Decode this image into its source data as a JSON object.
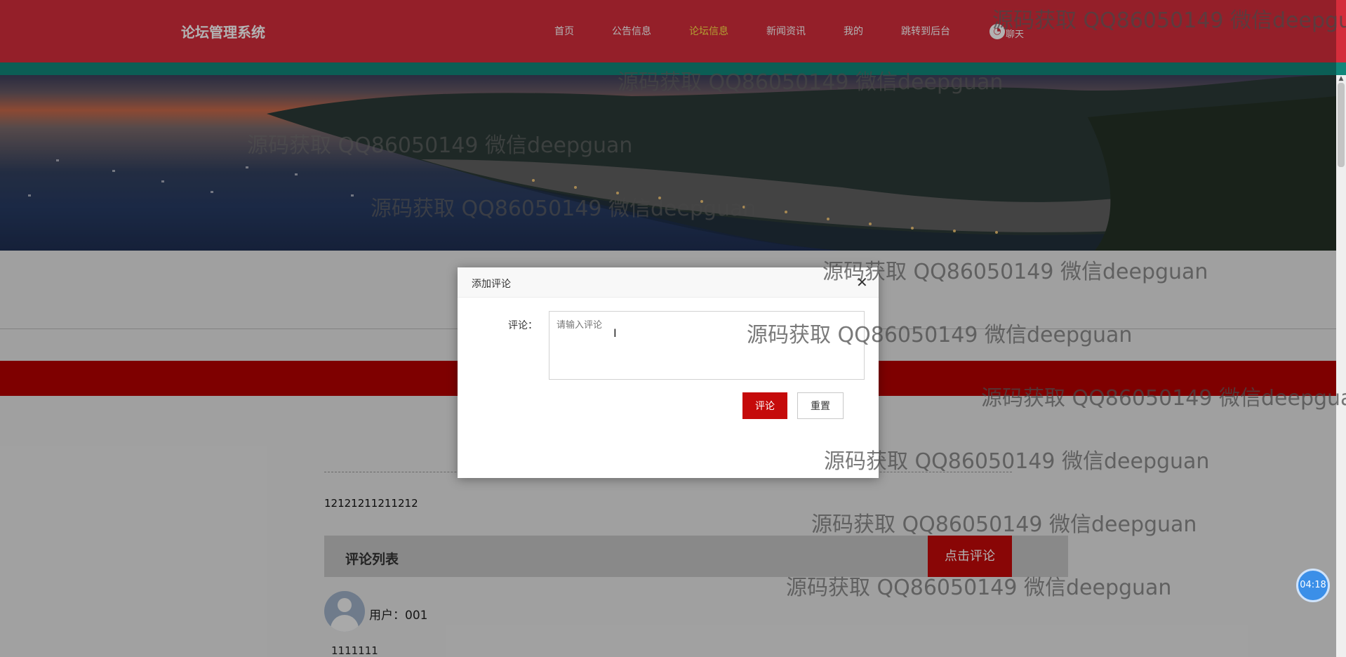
{
  "app": {
    "title": "论坛管理系统"
  },
  "nav": {
    "items": [
      {
        "label": "首页"
      },
      {
        "label": "公告信息"
      },
      {
        "label": "论坛信息",
        "active": true
      },
      {
        "label": "新闻资讯"
      },
      {
        "label": "我的"
      },
      {
        "label": "跳转到后台"
      }
    ],
    "chat_label": "聊天",
    "chat_icon": "chat-bubble-icon"
  },
  "colors": {
    "header": "#d42d3b",
    "stripe": "#10877a",
    "active_nav": "#ffe14a",
    "primary_button": "#c50a0a"
  },
  "post": {
    "content": "12121211211212"
  },
  "comments": {
    "title": "评论列表",
    "button_label": "点击评论",
    "items": [
      {
        "user_label": "用户：001",
        "text": "1111111"
      }
    ]
  },
  "modal": {
    "title": "添加评论",
    "close_icon": "close-icon",
    "field_label": "评论：",
    "placeholder": "请输入评论",
    "submit_label": "评论",
    "reset_label": "重置"
  },
  "timer": {
    "value": "04:18"
  },
  "watermark": {
    "text": "源码获取 QQ86050149 微信deepguan"
  }
}
